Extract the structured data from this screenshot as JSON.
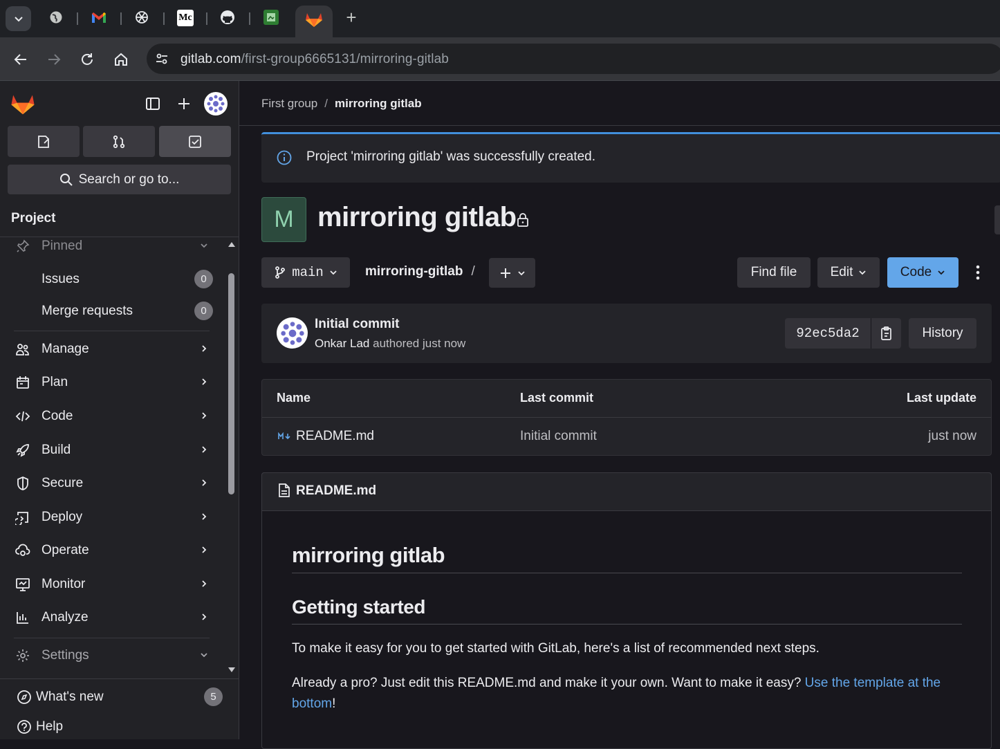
{
  "browser": {
    "tabs": [
      {
        "icon": "globe-icon"
      },
      {
        "icon": "gmail-icon"
      },
      {
        "icon": "chatgpt-icon"
      },
      {
        "icon": "medium-icon",
        "label": "Mc"
      },
      {
        "icon": "github-icon"
      },
      {
        "icon": "green-app-icon"
      },
      {
        "icon": "gitlab-icon",
        "active": true
      }
    ],
    "url_host": "gitlab.com",
    "url_path": "/first-group6665131/mirroring-gitlab"
  },
  "sidebar": {
    "search_label": "Search or go to...",
    "section_title": "Project",
    "pinned_label": "Pinned",
    "pinned_items": [
      {
        "label": "Issues",
        "count": "0"
      },
      {
        "label": "Merge requests",
        "count": "0"
      }
    ],
    "nav_items": [
      {
        "label": "Manage"
      },
      {
        "label": "Plan"
      },
      {
        "label": "Code"
      },
      {
        "label": "Build"
      },
      {
        "label": "Secure"
      },
      {
        "label": "Deploy"
      },
      {
        "label": "Operate"
      },
      {
        "label": "Monitor"
      },
      {
        "label": "Analyze"
      }
    ],
    "settings_label": "Settings",
    "whats_new_label": "What's new",
    "whats_new_count": "5",
    "help_label": "Help"
  },
  "breadcrumb": {
    "parent": "First group",
    "separator": "/",
    "current": "mirroring gitlab"
  },
  "alert": {
    "text": "Project 'mirroring gitlab' was successfully created."
  },
  "project": {
    "avatar_letter": "M",
    "name": "mirroring gitlab"
  },
  "repo_toolbar": {
    "branch": "main",
    "repo_path": "mirroring-gitlab",
    "path_separator": "/",
    "find_file": "Find file",
    "edit": "Edit",
    "code": "Code"
  },
  "last_commit": {
    "title": "Initial commit",
    "author": "Onkar Lad",
    "authored_text": "authored just now",
    "sha": "92ec5da2",
    "history": "History"
  },
  "file_table": {
    "headers": {
      "name": "Name",
      "last_commit": "Last commit",
      "last_update": "Last update"
    },
    "rows": [
      {
        "name": "README.md",
        "last_commit": "Initial commit",
        "last_update": "just now"
      }
    ]
  },
  "readme": {
    "filename": "README.md",
    "h1": "mirroring gitlab",
    "h2": "Getting started",
    "p1": "To make it easy for you to get started with GitLab, here's a list of recommended next steps.",
    "p2_text": "Already a pro? Just edit this README.md and make it your own. Want to make it easy? ",
    "p2_link": "Use the template at the bottom",
    "p2_end": "!"
  },
  "colors": {
    "accent_blue": "#63a6e9",
    "gitlab_orange": "#fc6d26"
  }
}
